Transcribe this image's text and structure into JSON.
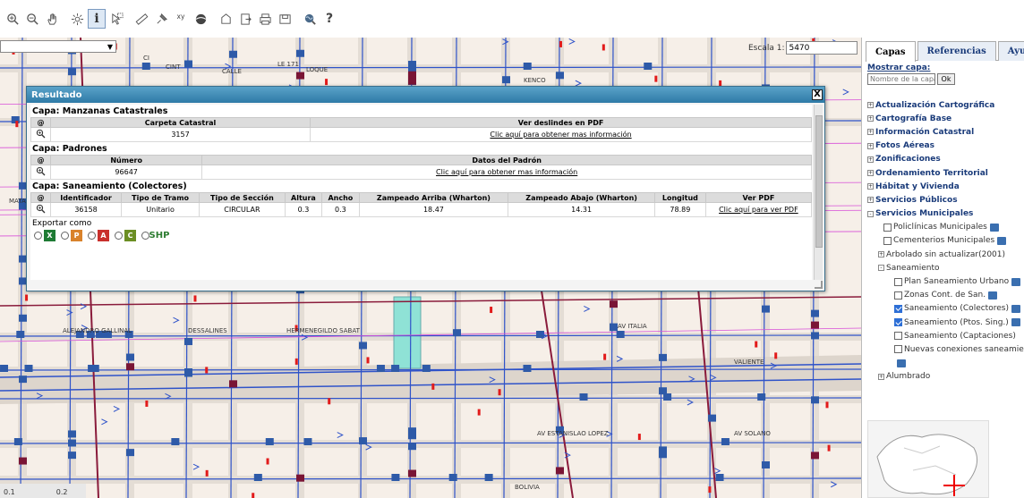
{
  "toolbar": {
    "tools": [
      {
        "name": "zoom-in-icon"
      },
      {
        "name": "zoom-out-icon"
      },
      {
        "name": "pan-hand-icon"
      },
      {
        "name": "zoom-extent-icon"
      },
      {
        "name": "info-icon"
      },
      {
        "name": "select-arrow-icon"
      },
      {
        "name": "measure-ruler-icon"
      },
      {
        "name": "pin-icon"
      },
      {
        "name": "xy-coordinate-icon"
      },
      {
        "name": "layers-icon"
      },
      {
        "name": "clear-icon"
      },
      {
        "name": "export-icon"
      },
      {
        "name": "print-icon"
      },
      {
        "name": "save-icon"
      },
      {
        "name": "search-globe-icon"
      },
      {
        "name": "help-icon"
      }
    ],
    "xy_label": "xy",
    "help_label": "?"
  },
  "map": {
    "select_value": "",
    "scale_label": "Escala 1:",
    "scale_value": "5470",
    "scalebar": {
      "left": "0.1",
      "right": "0.2"
    },
    "streets": [
      "CI",
      "CINT",
      "CALLE",
      "LE 171",
      "LOQUE",
      "KENCO",
      "MATAOJO",
      "DESSALINES",
      "HERMENEGILDO SABAT",
      "AV ITALIA",
      "VALIENTE",
      "AV ESTANISLAO LOPEZ",
      "AV SOLANO",
      "BOLIVIA",
      "ALEJANDRO GALLINAL"
    ]
  },
  "result": {
    "title": "Resultado",
    "close": "X",
    "layers": [
      {
        "caption": "Capa: Manzanas Catastrales",
        "headers": [
          "@",
          "Carpeta Catastral",
          "Ver deslindes en PDF"
        ],
        "rows": [
          [
            "",
            "3157",
            "Clic aquí para obtener mas información"
          ]
        ]
      },
      {
        "caption": "Capa: Padrones",
        "headers": [
          "@",
          "Número",
          "Datos del Padrón"
        ],
        "rows": [
          [
            "",
            "96647",
            "Clic aquí para obtener mas información"
          ]
        ]
      },
      {
        "caption": "Capa: Saneamiento (Colectores)",
        "headers": [
          "@",
          "Identificador",
          "Tipo de Tramo",
          "Tipo de Sección",
          "Altura",
          "Ancho",
          "Zampeado Arriba (Wharton)",
          "Zampeado Abajo (Wharton)",
          "Longitud",
          "Ver PDF"
        ],
        "rows": [
          [
            "",
            "36158",
            "Unitario",
            "CIRCULAR",
            "0.3",
            "0.3",
            "18.47",
            "14.31",
            "78.89",
            "Clic aquí para ver PDF"
          ]
        ]
      }
    ],
    "export_label": "Exportar como",
    "export_options": [
      {
        "name": "xls",
        "glyph": "X",
        "color": "#1e7b34"
      },
      {
        "name": "ppt",
        "glyph": "P",
        "color": "#d9822b"
      },
      {
        "name": "pdf",
        "glyph": "A",
        "color": "#c9302c"
      },
      {
        "name": "csv",
        "glyph": "C",
        "color": "#6b8e23"
      },
      {
        "name": "shp",
        "glyph": "SHP",
        "color": "#2e7d32"
      }
    ]
  },
  "panel": {
    "tabs": [
      "Capas",
      "Referencias",
      "Ayu"
    ],
    "mostrar_label": "Mostrar capa:",
    "mostrar_placeholder": "Nombre de la capa",
    "ok_label": "Ok",
    "tree": [
      {
        "label": "Actualización Cartográfica",
        "bold": true,
        "indent": 0,
        "pm": "+"
      },
      {
        "label": "Cartografía Base",
        "bold": true,
        "indent": 0,
        "pm": "+"
      },
      {
        "label": "Información Catastral",
        "bold": true,
        "indent": 0,
        "pm": "+"
      },
      {
        "label": "Fotos Aéreas",
        "bold": true,
        "indent": 0,
        "pm": "+"
      },
      {
        "label": "Zonificaciones",
        "bold": true,
        "indent": 0,
        "pm": "+"
      },
      {
        "label": "Ordenamiento Territorial",
        "bold": true,
        "indent": 0,
        "pm": "+"
      },
      {
        "label": "Hábitat y Vivienda",
        "bold": true,
        "indent": 0,
        "pm": "+"
      },
      {
        "label": "Servicios Públicos",
        "bold": true,
        "indent": 0,
        "pm": "+"
      },
      {
        "label": "Servicios Municipales",
        "bold": true,
        "indent": 0,
        "pm": "-"
      },
      {
        "label": "Policlínicas Municipales",
        "indent": 18,
        "cb": false,
        "icon": true
      },
      {
        "label": "Cementerios Municipales",
        "indent": 18,
        "cb": false,
        "icon": true
      },
      {
        "label": "Arbolado sin actualizar(2001)",
        "indent": 12,
        "pm": "+"
      },
      {
        "label": "Saneamiento",
        "indent": 12,
        "pm": "-"
      },
      {
        "label": "Plan Saneamiento Urbano",
        "indent": 30,
        "cb": false,
        "icon": true
      },
      {
        "label": "Zonas Cont. de San.",
        "indent": 30,
        "cb": false,
        "icon": true
      },
      {
        "label": "Saneamiento (Colectores)",
        "indent": 30,
        "cb": true,
        "icon": true
      },
      {
        "label": "Saneamiento (Ptos. Sing.)",
        "indent": 30,
        "cb": true,
        "icon": true
      },
      {
        "label": "Saneamiento (Captaciones)",
        "indent": 30,
        "cb": false
      },
      {
        "label": "Nuevas conexiones saneamiento",
        "indent": 30,
        "cb": false
      },
      {
        "label": "",
        "indent": 30,
        "icon": true
      },
      {
        "label": "Alumbrado",
        "indent": 12,
        "pm": "+"
      }
    ]
  }
}
